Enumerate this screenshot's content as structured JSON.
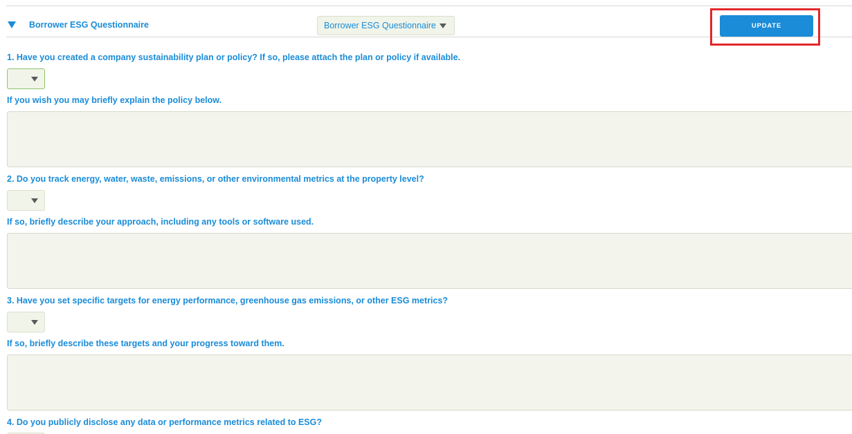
{
  "section": {
    "toggle_icon": "triangle-down-icon",
    "title": "Borrower ESG Questionnaire"
  },
  "form_select": {
    "selected": "Borrower ESG Questionnaire",
    "icon": "chevron-down-icon"
  },
  "update_button": {
    "label": "UPDATE",
    "highlighted": true
  },
  "colors": {
    "accent": "#1a8cd8",
    "highlight": "#e2262b",
    "field_bg": "#f1f4e9",
    "field_border": "#dadfcd"
  },
  "questions": [
    {
      "question": "1. Have you created a company sustainability plan or policy? If so, please attach the plan or policy if available.",
      "answer": "",
      "follow_up": "If you wish you may briefly explain the policy below.",
      "explanation": ""
    },
    {
      "question": "2. Do you track energy, water, waste, emissions, or other environmental metrics at the property level?",
      "answer": "",
      "follow_up": "If so, briefly describe your approach, including any tools or software used.",
      "explanation": ""
    },
    {
      "question": "3. Have you set specific targets for energy performance, greenhouse gas emissions, or other ESG metrics?",
      "answer": "",
      "follow_up": "If so, briefly describe these targets and your progress toward them.",
      "explanation": ""
    },
    {
      "question": "4. Do you publicly disclose any data or performance metrics related to ESG?",
      "answer": ""
    }
  ]
}
